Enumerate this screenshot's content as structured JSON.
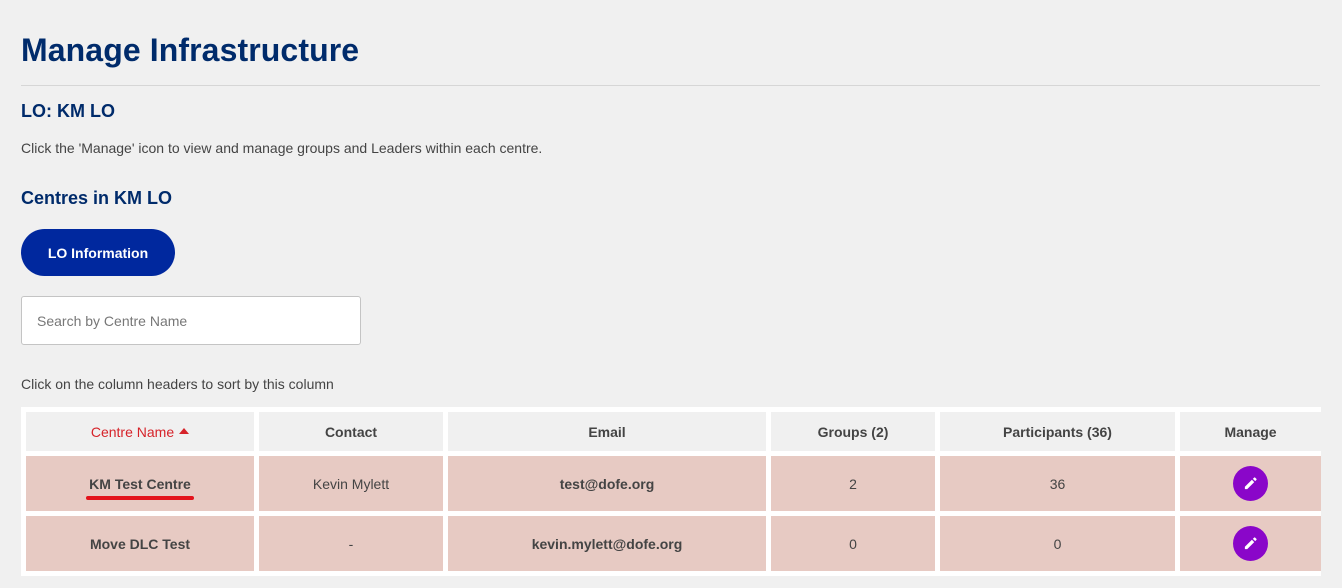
{
  "page": {
    "title": "Manage Infrastructure",
    "lo_heading": "LO: KM LO",
    "instructions": "Click the 'Manage' icon to view and manage groups and Leaders within each centre.",
    "centres_heading": "Centres in KM LO"
  },
  "actions": {
    "lo_info_label": "LO Information"
  },
  "search": {
    "placeholder": "Search by Centre Name",
    "value": ""
  },
  "table": {
    "sort_hint": "Click on the column headers to sort by this column",
    "headers": {
      "centre_name": "Centre Name",
      "contact": "Contact",
      "email": "Email",
      "groups": "Groups (2)",
      "participants": "Participants (36)",
      "manage": "Manage"
    },
    "sorted_column": "centre_name",
    "sort_direction": "ascending",
    "rows": [
      {
        "centre_name": "KM Test Centre",
        "contact": "Kevin Mylett",
        "email": "test@dofe.org",
        "groups": "2",
        "participants": "36",
        "manage_icon": "pencil-icon"
      },
      {
        "centre_name": "Move DLC Test",
        "contact": "-",
        "email": "kevin.mylett@dofe.org",
        "groups": "0",
        "participants": "0",
        "manage_icon": "pencil-icon"
      }
    ]
  },
  "colors": {
    "heading": "#002b6b",
    "primary_button": "#00289e",
    "sorted_header": "#d6232a",
    "row_background": "#e7cac3",
    "manage_button": "#8a06c9",
    "annotation_underline": "#e3131b"
  }
}
